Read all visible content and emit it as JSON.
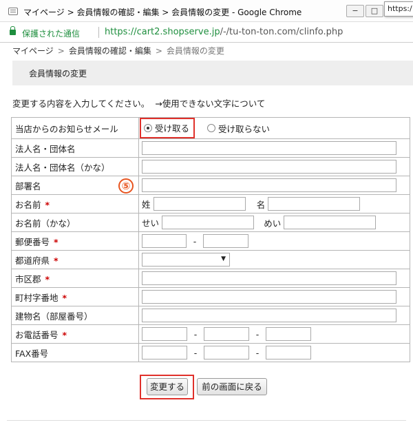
{
  "window": {
    "title": "マイページ > 会員情報の確認・編集 > 会員情報の変更 - Google Chrome",
    "minimize_glyph": "−",
    "maximize_glyph": "□",
    "tooltip": "https:/"
  },
  "addressbar": {
    "secure_label": "保護された通信",
    "url_main": "https://cart2.shopserve.jp",
    "url_rest": "/-/tu-ton-ton.com/clinfo.php"
  },
  "breadcrumb": {
    "items": [
      "マイページ",
      "会員情報の確認・編集",
      "会員情報の変更"
    ],
    "separator": ">"
  },
  "section_title": "会員情報の変更",
  "intro": {
    "text": "変更する内容を入力してください。",
    "link": "→使用できない文字について"
  },
  "form": {
    "newsletter": {
      "label": "当店からのお知らせメール",
      "options": [
        "受け取る",
        "受け取らない"
      ],
      "selected": "受け取る"
    },
    "company": {
      "label": "法人名・団体名",
      "value": ""
    },
    "company_kana": {
      "label": "法人名・団体名（かな）",
      "value": ""
    },
    "department": {
      "label": "部署名",
      "value": ""
    },
    "name": {
      "label": "お名前",
      "required_mark": "*",
      "last_label": "姓",
      "first_label": "名",
      "last_value": "",
      "first_value": ""
    },
    "name_kana": {
      "label": "お名前（かな）",
      "last_label": "せい",
      "first_label": "めい",
      "last_value": "",
      "first_value": ""
    },
    "postal": {
      "label": "郵便番号",
      "required_mark": "*",
      "separator": "-",
      "part1": "",
      "part2": ""
    },
    "prefecture": {
      "label": "都道府県",
      "required_mark": "*",
      "selected": "",
      "arrow": "▼"
    },
    "city": {
      "label": "市区郡",
      "required_mark": "*",
      "value": ""
    },
    "town": {
      "label": "町村字番地",
      "required_mark": "*",
      "value": ""
    },
    "building": {
      "label": "建物名（部屋番号）",
      "value": ""
    },
    "phone": {
      "label": "お電話番号",
      "required_mark": "*",
      "separator": "-"
    },
    "fax": {
      "label": "FAX番号",
      "separator": "-"
    }
  },
  "step_badge": "⑤",
  "buttons": {
    "submit": "変更する",
    "back": "前の画面に戻る"
  },
  "colors": {
    "secure_green": "#1e8e3e",
    "highlight_red": "#e0302a",
    "required_red": "#cc0000",
    "badge_orange": "#e8541f"
  }
}
